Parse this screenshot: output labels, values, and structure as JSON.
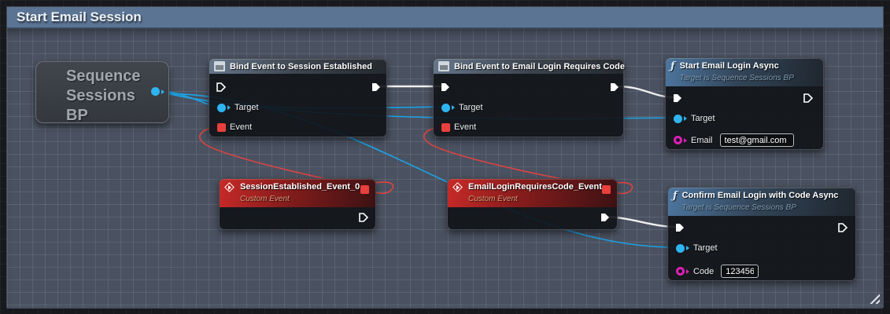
{
  "comment": {
    "title": "Start Email Session"
  },
  "nodes": {
    "sequence_bp": {
      "line1": "Sequence",
      "line2": "Sessions",
      "line3": "BP"
    },
    "bind_session_established": {
      "title": "Bind Event to Session Established",
      "pin_target": "Target",
      "pin_event": "Event"
    },
    "bind_email_login_requires_code": {
      "title": "Bind Event to Email Login Requires Code",
      "pin_target": "Target",
      "pin_event": "Event"
    },
    "start_email_login_async": {
      "title": "Start Email Login Async",
      "subtitle": "Target is Sequence Sessions BP",
      "pin_target": "Target",
      "pin_email": "Email",
      "email_value": "test@gmail.com"
    },
    "session_established_event": {
      "title": "SessionEstablished_Event_0",
      "subtitle": "Custom Event"
    },
    "email_login_requires_code_event": {
      "title": "EmailLoginRequiresCode_Event",
      "subtitle": "Custom Event"
    },
    "confirm_email_login_async": {
      "title": "Confirm Email Login with Code Async",
      "subtitle": "Target is Sequence Sessions BP",
      "pin_target": "Target",
      "pin_code": "Code",
      "code_value": "123456"
    }
  },
  "colors": {
    "comment_header": "#5b7494",
    "canvas_bg": "#17191d",
    "comment_bg": "#4a5160",
    "exec_wire": "#efefef",
    "object_wire": "#1f9ede",
    "delegate_wire": "#d64444",
    "object_pin": "#2eb5f0",
    "delegate_pin": "#e8403d",
    "string_pin": "#dd1fb7",
    "bind_header": "#66778c",
    "function_header": "#4d76a0",
    "event_header": "#c72a28"
  }
}
